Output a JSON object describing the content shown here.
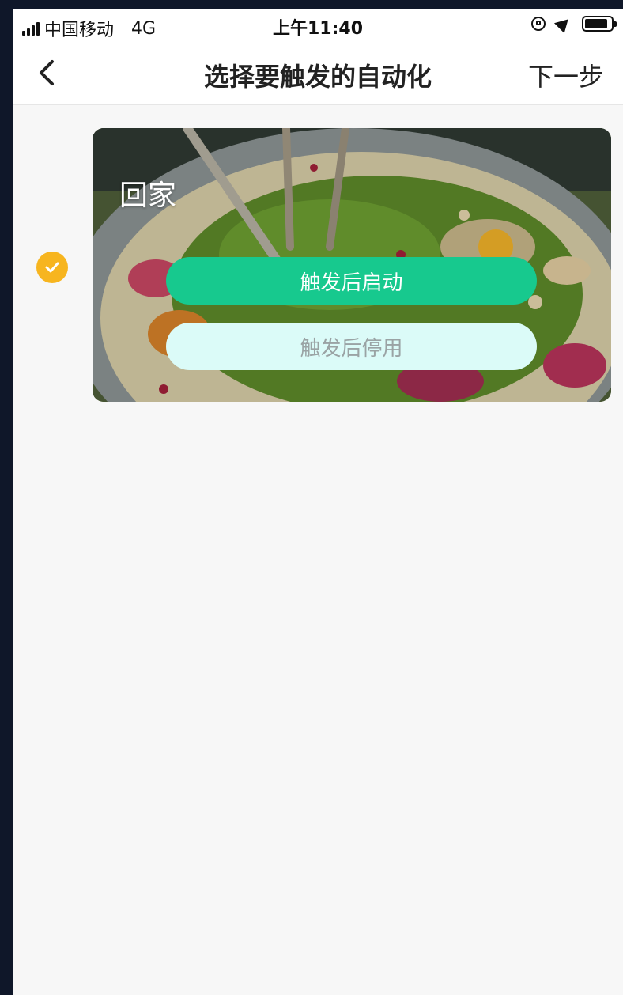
{
  "status_bar": {
    "carrier": "中国移动",
    "network": "4G",
    "time": "上午11:40"
  },
  "nav": {
    "title": "选择要触发的自动化",
    "next_label": "下一步",
    "back_icon": "chevron-left-icon"
  },
  "automations": [
    {
      "name": "回家",
      "selected": true,
      "enable_label": "触发后启动",
      "disable_label": "触发后停用"
    }
  ],
  "colors": {
    "accent_green": "#17c98e",
    "check_yellow": "#f7b51f",
    "disable_bg": "#dbfbf8"
  }
}
